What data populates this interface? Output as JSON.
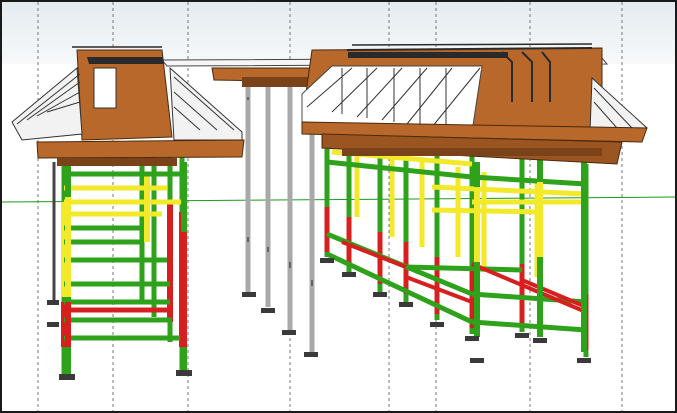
{
  "viewport": {
    "name": "3d-model-viewport",
    "sky_color": "#dde6ec",
    "ground_color": "#ffffff",
    "frame_color": "#1a1a1a"
  },
  "materials": {
    "formwork_timber": "#b7682a",
    "timber_shadow": "#7a4218",
    "deck_white": "#f6f6f6",
    "steel_gray": "#a9a9a9",
    "frame_green": "#2fa21c",
    "frame_yellow": "#f1e92a",
    "frame_red": "#d81f1f",
    "base_plate": "#3a3a3a",
    "rebar": "#2a2a2a"
  },
  "objects": {
    "left_falsework": "left-shoring-tower",
    "center_props": "adjustable-steel-props",
    "right_falsework": "right-shoring-tower",
    "formwork": "beam-formwork-with-truss-supports"
  }
}
